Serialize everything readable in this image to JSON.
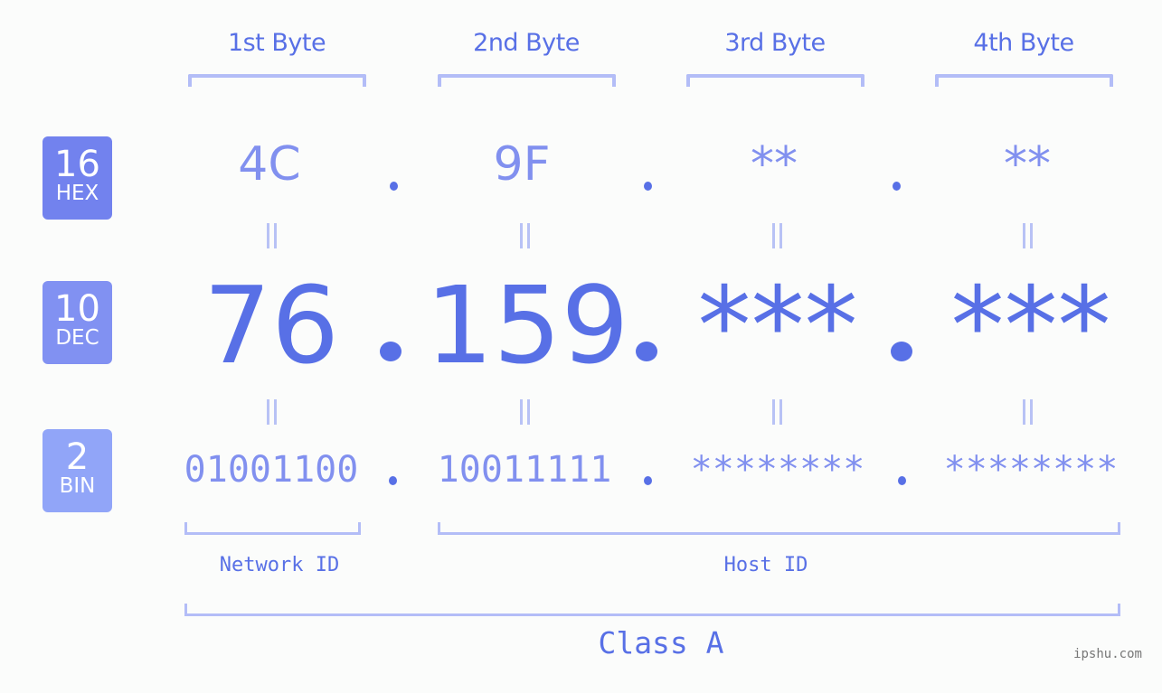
{
  "headers": [
    "1st Byte",
    "2nd Byte",
    "3rd Byte",
    "4th Byte"
  ],
  "rows": {
    "hex": {
      "base": "16",
      "label": "HEX",
      "values": [
        "4C",
        "9F",
        "**",
        "**"
      ],
      "color": "#7282ee"
    },
    "dec": {
      "base": "10",
      "label": "DEC",
      "values": [
        "76",
        "159",
        "***",
        "***"
      ],
      "color": "#8191f2"
    },
    "bin": {
      "base": "2",
      "label": "BIN",
      "values": [
        "01001100",
        "10011111",
        "********",
        "********"
      ],
      "color": "#91a5f8"
    }
  },
  "separator": ".",
  "network_label": "Network ID",
  "host_label": "Host ID",
  "class_label": "Class A",
  "watermark": "ipshu.com",
  "colors": {
    "primary": "#5870e6",
    "secondary": "#8190ef",
    "bracket": "#b3bdf7",
    "background": "#fbfcfb"
  }
}
